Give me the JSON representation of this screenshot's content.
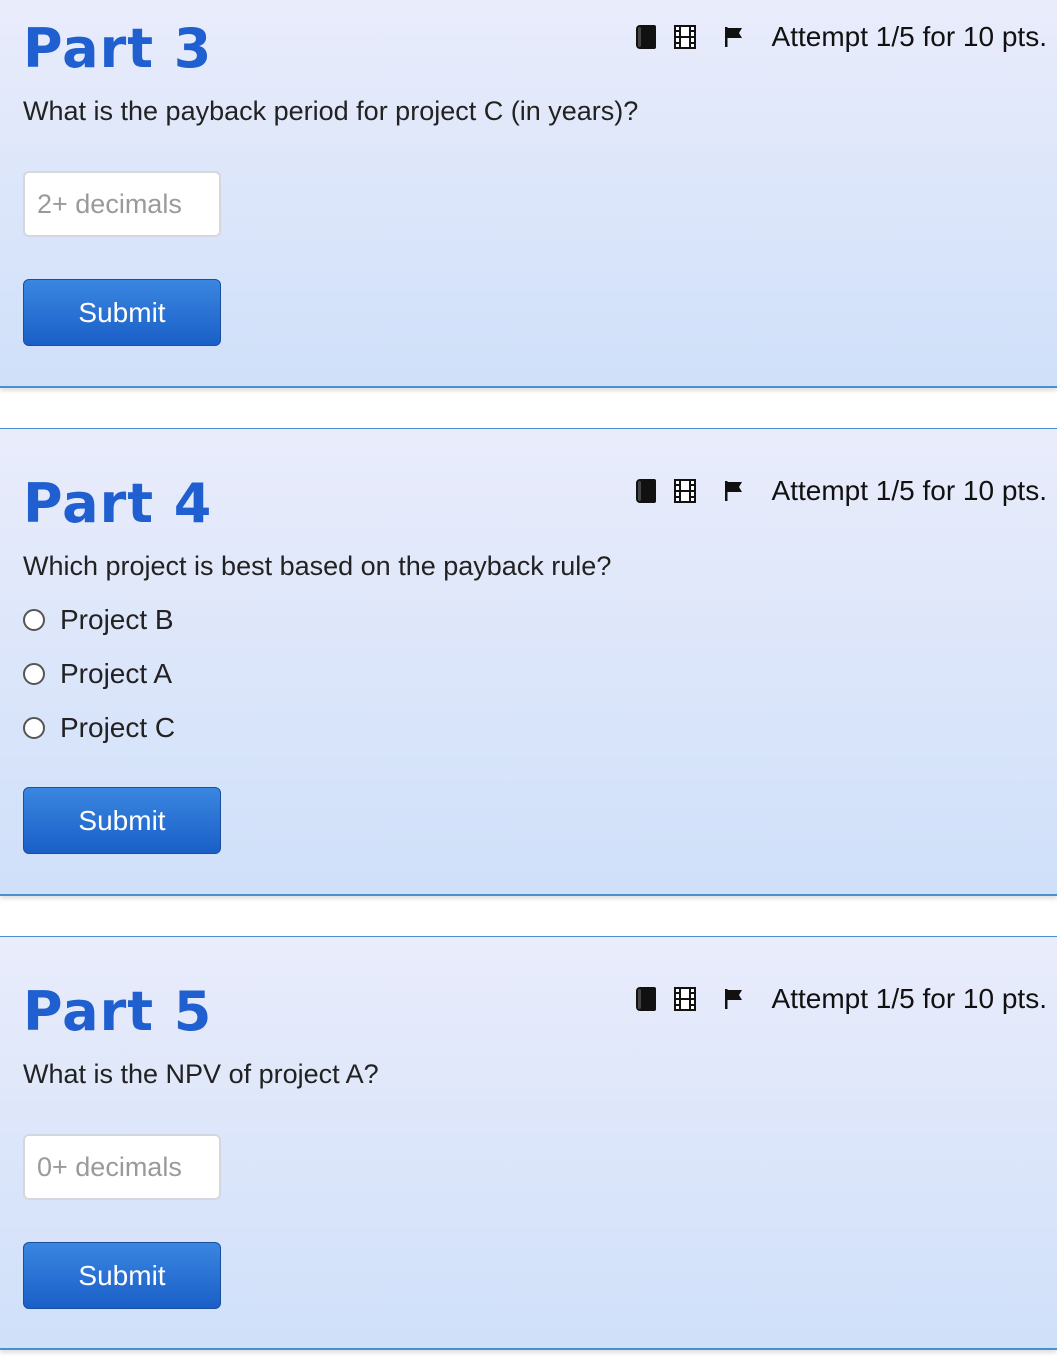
{
  "parts": [
    {
      "title": "Part 3",
      "attempt": "Attempt 1/5 for 10 pts.",
      "question": "What is the payback period for project C (in years)?",
      "input_placeholder": "2+ decimals",
      "submit_label": "Submit"
    },
    {
      "title": "Part 4",
      "attempt": "Attempt 1/5 for 10 pts.",
      "question": "Which project is best based on the payback rule?",
      "options": [
        "Project B",
        "Project A",
        "Project C"
      ],
      "submit_label": "Submit"
    },
    {
      "title": "Part 5",
      "attempt": "Attempt 1/5 for 10 pts.",
      "question": "What is the NPV of project A?",
      "input_placeholder": "0+ decimals",
      "submit_label": "Submit"
    }
  ],
  "icons": [
    "book-icon",
    "film-icon",
    "flag-icon"
  ],
  "colors": {
    "title": "#1f5fcf",
    "button": "#1a5fc8",
    "border": "#4a8fd0"
  }
}
